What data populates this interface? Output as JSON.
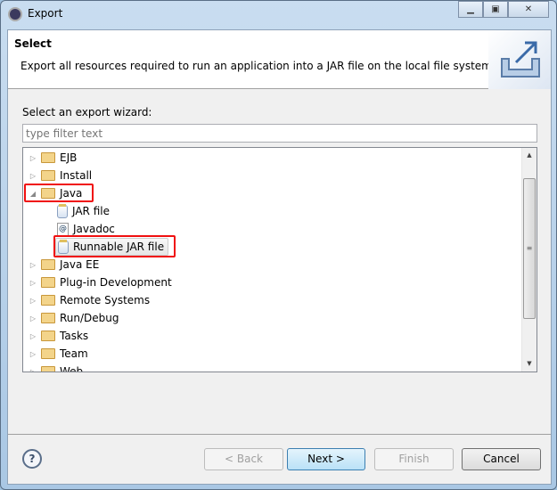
{
  "window": {
    "title": "Export",
    "controls": [
      "minimize",
      "maximize",
      "close"
    ]
  },
  "header": {
    "title": "Select",
    "description": "Export all resources required to run an application into a JAR file on the local file system.",
    "image": "export-wizard-icon"
  },
  "filter": {
    "label": "Select an export wizard:",
    "placeholder": "type filter text",
    "value": ""
  },
  "tree": {
    "items": [
      {
        "label": "EJB",
        "level": 0,
        "type": "folder",
        "expanded": false
      },
      {
        "label": "Install",
        "level": 0,
        "type": "folder",
        "expanded": false
      },
      {
        "label": "Java",
        "level": 0,
        "type": "folder",
        "expanded": true,
        "highlighted": true
      },
      {
        "label": "JAR file",
        "level": 1,
        "type": "jar"
      },
      {
        "label": "Javadoc",
        "level": 1,
        "type": "javadoc"
      },
      {
        "label": "Runnable JAR file",
        "level": 1,
        "type": "runnable-jar",
        "selected": true,
        "highlighted": true
      },
      {
        "label": "Java EE",
        "level": 0,
        "type": "folder",
        "expanded": false
      },
      {
        "label": "Plug-in Development",
        "level": 0,
        "type": "folder",
        "expanded": false
      },
      {
        "label": "Remote Systems",
        "level": 0,
        "type": "folder",
        "expanded": false
      },
      {
        "label": "Run/Debug",
        "level": 0,
        "type": "folder",
        "expanded": false
      },
      {
        "label": "Tasks",
        "level": 0,
        "type": "folder",
        "expanded": false
      },
      {
        "label": "Team",
        "level": 0,
        "type": "folder",
        "expanded": false
      },
      {
        "label": "Web",
        "level": 0,
        "type": "folder",
        "expanded": false
      }
    ]
  },
  "buttons": {
    "back": "< Back",
    "next": "Next >",
    "finish": "Finish",
    "cancel": "Cancel"
  },
  "colors": {
    "highlight": "#f01010",
    "default_button": "#3c7fb1"
  }
}
